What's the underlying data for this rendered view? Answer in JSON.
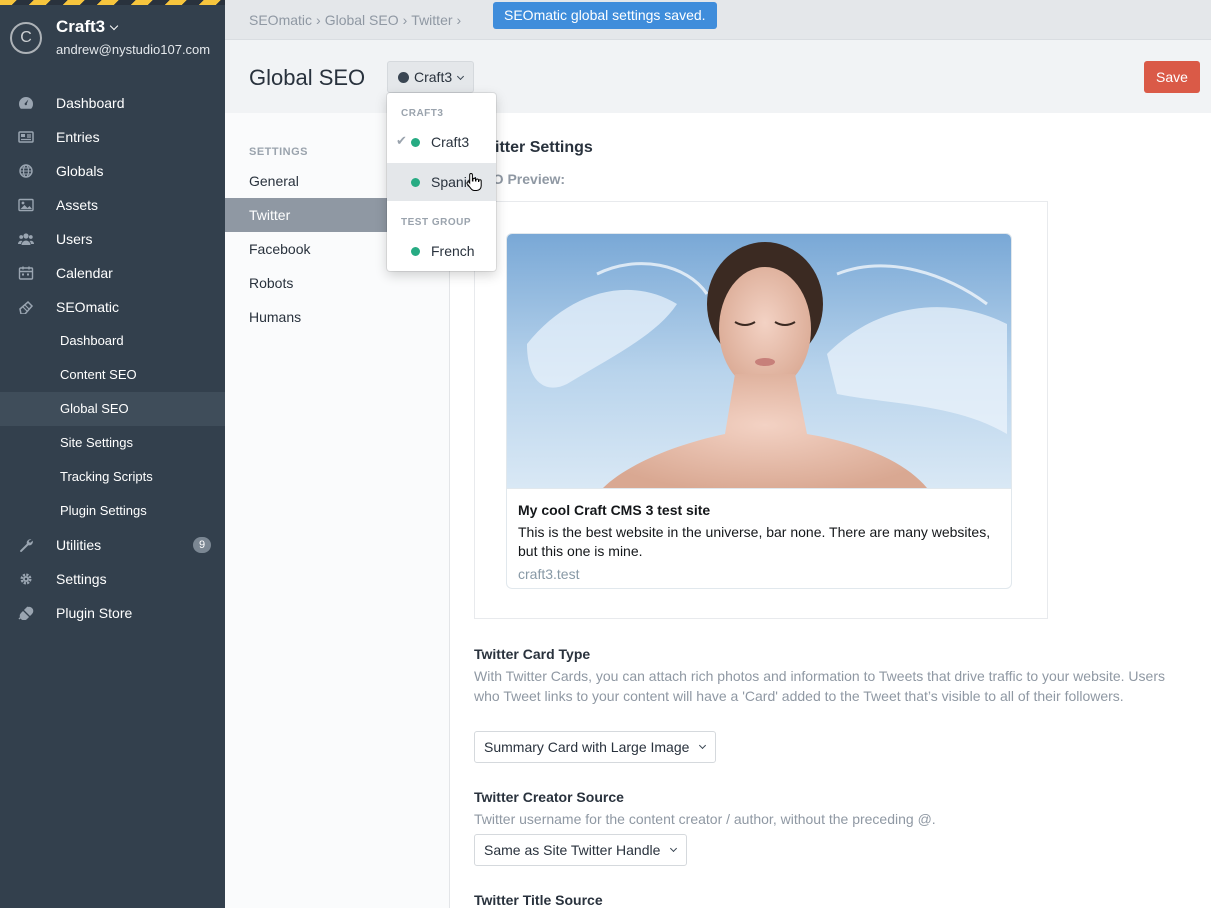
{
  "sidebar": {
    "site_logo_letter": "C",
    "site_name": "Craft3",
    "user_email": "andrew@nystudio107.com",
    "nav": [
      {
        "label": "Dashboard",
        "icon": "gauge-icon"
      },
      {
        "label": "Entries",
        "icon": "newspaper-icon"
      },
      {
        "label": "Globals",
        "icon": "globe-icon"
      },
      {
        "label": "Assets",
        "icon": "image-icon"
      },
      {
        "label": "Users",
        "icon": "users-icon"
      },
      {
        "label": "Calendar",
        "icon": "calendar-icon"
      },
      {
        "label": "SEOmatic",
        "icon": "seomatic-icon"
      },
      {
        "label": "Dashboard"
      },
      {
        "label": "Content SEO"
      },
      {
        "label": "Global SEO"
      },
      {
        "label": "Site Settings"
      },
      {
        "label": "Tracking Scripts"
      },
      {
        "label": "Plugin Settings"
      },
      {
        "label": "Utilities",
        "icon": "wrench-icon",
        "badge": "9"
      },
      {
        "label": "Settings",
        "icon": "gear-icon"
      },
      {
        "label": "Plugin Store",
        "icon": "plug-icon"
      }
    ]
  },
  "topbar": {
    "breadcrumb": [
      "SEOmatic",
      "Global SEO",
      "Twitter"
    ],
    "separator": "›",
    "notice": "SEOmatic global settings saved."
  },
  "header": {
    "title": "Global SEO",
    "site_menu_label": "Craft3",
    "save_label": "Save"
  },
  "site_menu": {
    "group_1": "CRAFT3",
    "group_2": "TEST GROUP",
    "items": [
      "Craft3",
      "Spanish",
      "French"
    ],
    "check_glyph": "✔",
    "status_color": "#27ab83"
  },
  "settings_nav": {
    "heading": "SETTINGS",
    "items": [
      "General",
      "Twitter",
      "Facebook",
      "Robots",
      "Humans"
    ]
  },
  "content": {
    "section_title": "Twitter Settings",
    "preview_label": "SEO Preview:",
    "card": {
      "title": "My cool Craft CMS 3 test site",
      "description": "This is the best website in the universe, bar none. There are many websites, but this one is mine.",
      "domain": "craft3.test"
    },
    "card_type": {
      "label": "Twitter Card Type",
      "help": "With Twitter Cards, you can attach rich photos and information to Tweets that drive traffic to your website. Users who Tweet links to your content will have a 'Card' added to the Tweet that’s visible to all of their followers.",
      "value": "Summary Card with Large Image"
    },
    "creator_source": {
      "label": "Twitter Creator Source",
      "help": "Twitter username for the content creator / author, without the preceding @.",
      "value": "Same as Site Twitter Handle"
    },
    "title_source": {
      "label": "Twitter Title Source"
    }
  },
  "colors": {
    "sidebar": "#33404d",
    "accent_save": "#da5a47",
    "notice": "#3f8ddb",
    "active_settings_item": "#8f98a3"
  }
}
